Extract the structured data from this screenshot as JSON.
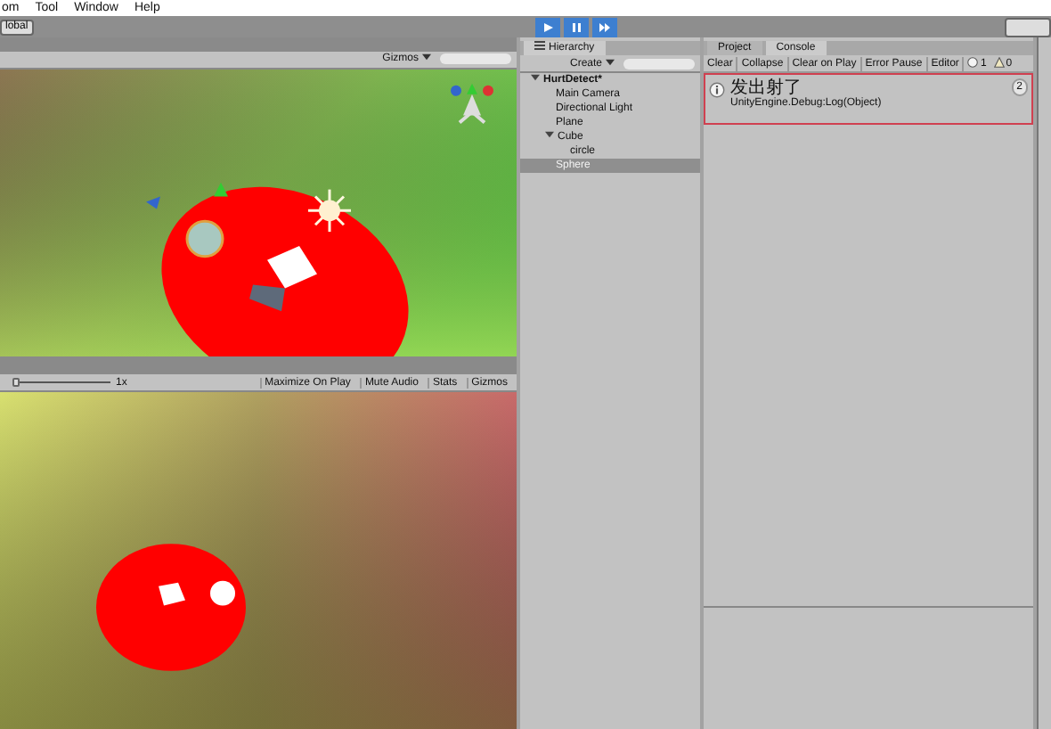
{
  "menu": [
    "om",
    "Tool",
    "Window",
    "Help"
  ],
  "toolbar": {
    "pivot_button": "lobal"
  },
  "scene": {
    "gizmos": "Gizmos"
  },
  "game": {
    "scale": "1x",
    "scale_slider": {
      "level": 0
    },
    "buttons": [
      "Maximize On Play",
      "Mute Audio",
      "Stats",
      "Gizmos"
    ]
  },
  "hierarchy": {
    "tab": "Hierarchy",
    "create": "Create",
    "items": [
      {
        "label": "HurtDetect*",
        "kind": "scene",
        "expanded": true,
        "selected": false,
        "children": [
          {
            "label": "Main Camera",
            "selected": false
          },
          {
            "label": "Directional Light",
            "selected": false
          },
          {
            "label": "Plane",
            "selected": false
          },
          {
            "label": "Cube",
            "expanded": true,
            "selected": false,
            "children": [
              {
                "label": "circle",
                "selected": false
              }
            ]
          },
          {
            "label": "Sphere",
            "selected": true
          }
        ]
      }
    ]
  },
  "console": {
    "tabs": [
      {
        "label": "Project",
        "selected": false
      },
      {
        "label": "Console",
        "selected": true
      }
    ],
    "buttons": [
      "Clear",
      "Collapse",
      "Clear on Play",
      "Error Pause",
      "Editor"
    ],
    "counts": [
      {
        "kind": "info",
        "value": "1"
      },
      {
        "kind": "warning",
        "value": "0"
      }
    ],
    "entries": [
      {
        "message": "发出射了",
        "trace": "UnityEngine.Debug:Log(Object)",
        "count": "2"
      }
    ]
  }
}
